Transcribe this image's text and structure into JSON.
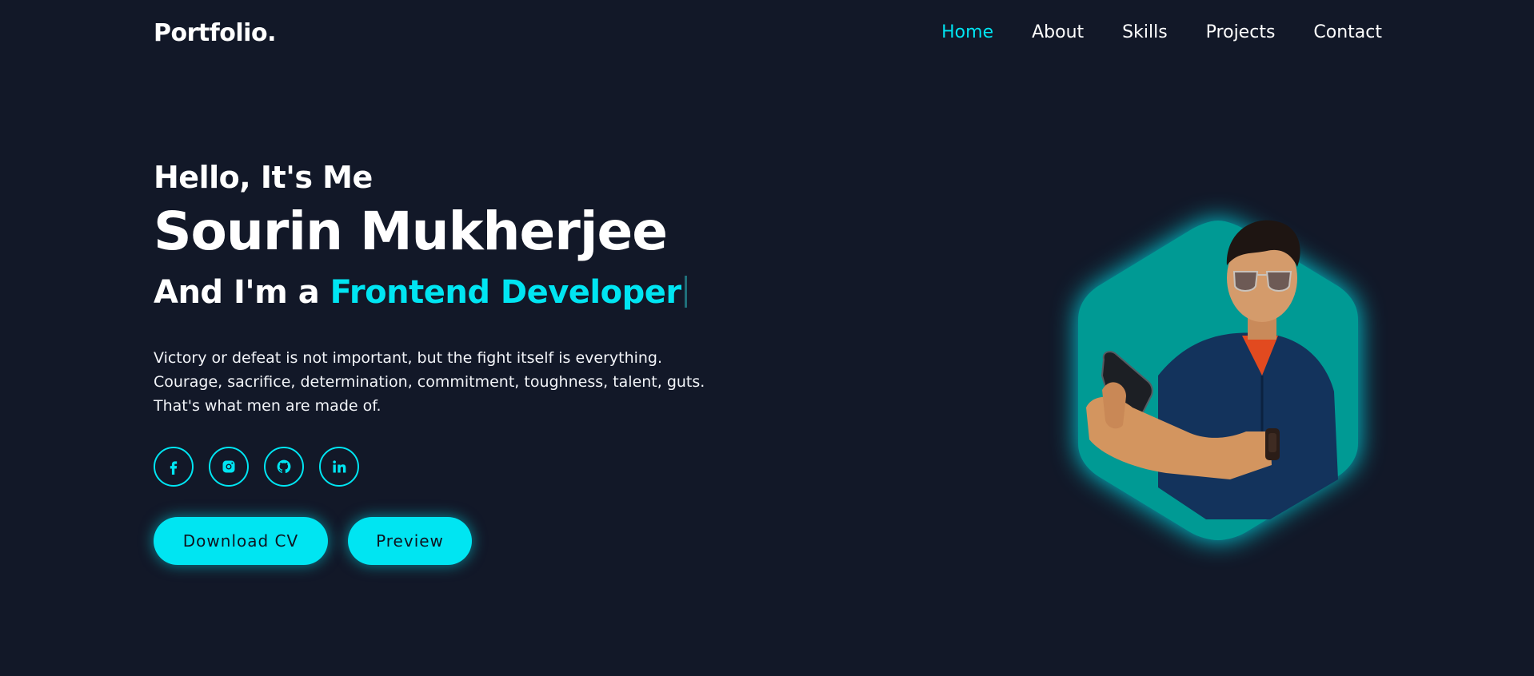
{
  "header": {
    "logo": "Portfolio.",
    "nav": [
      {
        "label": "Home",
        "active": true
      },
      {
        "label": "About",
        "active": false
      },
      {
        "label": "Skills",
        "active": false
      },
      {
        "label": "Projects",
        "active": false
      },
      {
        "label": "Contact",
        "active": false
      }
    ]
  },
  "hero": {
    "greeting": "Hello, It's Me",
    "name": "Sourin Mukherjee",
    "role_prefix": "And I'm a",
    "role_highlight": "Frontend Developer",
    "bio": [
      "Victory or defeat is not important, but the fight itself is everything.",
      "Courage, sacrifice, determination, commitment, toughness, talent, guts.",
      "That's what men are made of."
    ],
    "socials": [
      {
        "icon": "facebook-icon"
      },
      {
        "icon": "instagram-icon"
      },
      {
        "icon": "github-icon"
      },
      {
        "icon": "linkedin-icon"
      }
    ],
    "buttons": {
      "download": "Download CV",
      "preview": "Preview"
    }
  },
  "colors": {
    "background": "#121828",
    "accent": "#00e5f2",
    "hex_fill": "#009a94"
  }
}
